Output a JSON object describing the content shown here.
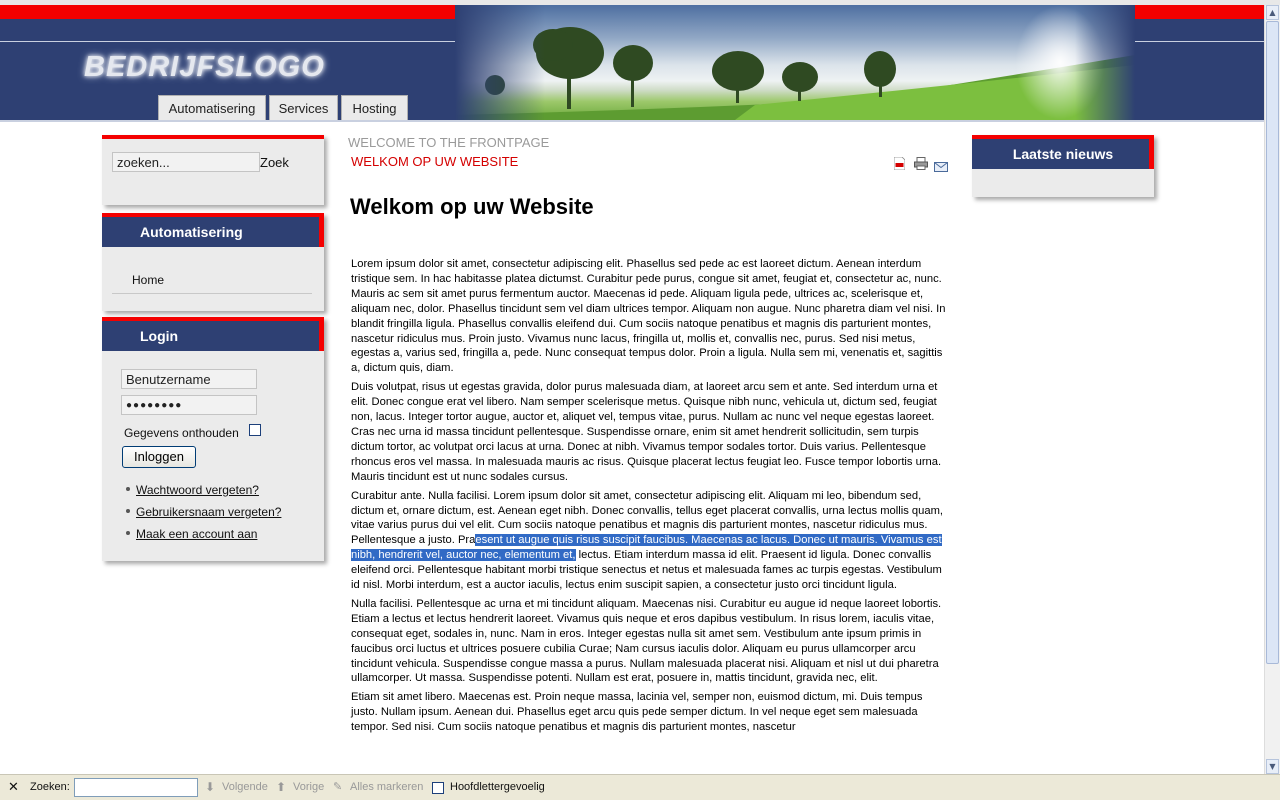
{
  "header": {
    "logo": "BEDRIJFSLOGO",
    "nav_tabs": [
      {
        "label": "Automatisering"
      },
      {
        "label": "Services"
      },
      {
        "label": "Hosting"
      }
    ]
  },
  "search_panel": {
    "input_value": "zoeken...",
    "button_label": "Zoek"
  },
  "menu_panel": {
    "title": "Automatisering",
    "items": [
      {
        "label": "Home"
      }
    ]
  },
  "login_panel": {
    "title": "Login",
    "username_value": "Benutzername",
    "password_value": "●●●●●●●●",
    "remember_label": "Gegevens onthouden",
    "login_button": "Inloggen",
    "links": [
      {
        "label": "Wachtwoord vergeten?"
      },
      {
        "label": "Gebruikersnaam vergeten?"
      },
      {
        "label": "Maak een account aan"
      }
    ]
  },
  "news_panel": {
    "title": "Laatste nieuws"
  },
  "content": {
    "pathway": "WELCOME TO THE FRONTPAGE",
    "section_title": "WELKOM OP UW WEBSITE",
    "heading": "Welkom op uw Website",
    "icons": [
      "pdf-icon",
      "print-icon",
      "email-icon"
    ],
    "paragraphs": [
      "Lorem ipsum dolor sit amet, consectetur adipiscing elit. Phasellus sed pede ac est laoreet dictum. Aenean interdum tristique sem. In hac habitasse platea dictumst. Curabitur pede purus, congue sit amet, feugiat et, consectetur ac, nunc. Mauris ac sem sit amet purus fermentum auctor. Maecenas id pede. Aliquam ligula pede, ultrices ac, scelerisque et, aliquam nec, dolor. Phasellus tincidunt sem vel diam ultrices tempor. Aliquam non augue. Nunc pharetra diam vel nisi. In blandit fringilla ligula. Phasellus convallis eleifend dui. Cum sociis natoque penatibus et magnis dis parturient montes, nascetur ridiculus mus. Proin justo. Vivamus nunc lacus, fringilla ut, mollis et, convallis nec, purus. Sed nisi metus, egestas a, varius sed, fringilla a, pede. Nunc consequat tempus dolor. Proin a ligula. Nulla sem mi, venenatis et, sagittis a, dictum quis, diam.",
      "Duis volutpat, risus ut egestas gravida, dolor purus malesuada diam, at laoreet arcu sem et ante. Sed interdum urna et elit. Donec congue erat vel libero. Nam semper scelerisque metus. Quisque nibh nunc, vehicula ut, dictum sed, feugiat non, lacus. Integer tortor augue, auctor et, aliquet vel, tempus vitae, purus. Nullam ac nunc vel neque egestas laoreet. Cras nec urna id massa tincidunt pellentesque. Suspendisse ornare, enim sit amet hendrerit sollicitudin, sem turpis dictum tortor, ac volutpat orci lacus at urna. Donec at nibh. Vivamus tempor sodales tortor. Duis varius. Pellentesque rhoncus eros vel massa. In malesuada mauris ac risus. Quisque placerat lectus feugiat leo. Fusce tempor lobortis urna. Mauris tincidunt est ut nunc sodales cursus."
    ],
    "para3_before": "Curabitur ante. Nulla facilisi. Lorem ipsum dolor sit amet, consectetur adipiscing elit. Aliquam mi leo, bibendum sed, dictum et, ornare dictum, est. Aenean eget nibh. Donec convallis, tellus eget placerat convallis, urna lectus mollis quam, vitae varius purus dui vel elit. Cum sociis natoque penatibus et magnis dis parturient montes, nascetur ridiculus mus. Pellentesque a justo. Pra",
    "para3_highlight": "esent ut augue quis risus suscipit faucibus. Maecenas ac lacus. Donec ut mauris. Vivamus est nibh, hendrerit vel, auctor nec, elementum et,",
    "para3_after": " lectus. Etiam interdum massa id elit. Praesent id ligula. Donec convallis eleifend orci. Pellentesque habitant morbi tristique senectus et netus et malesuada fames ac turpis egestas. Vestibulum id nisl. Morbi interdum, est a auctor iaculis, lectus enim suscipit sapien, a consectetur justo orci tincidunt ligula.",
    "para4": "Nulla facilisi. Pellentesque ac urna et mi tincidunt aliquam. Maecenas nisi. Curabitur eu augue id neque laoreet lobortis. Etiam a lectus et lectus hendrerit laoreet. Vivamus quis neque et eros dapibus vestibulum. In risus lorem, iaculis vitae, consequat eget, sodales in, nunc. Nam in eros. Integer egestas nulla sit amet sem. Vestibulum ante ipsum primis in faucibus orci luctus et ultrices posuere cubilia Curae; Nam cursus iaculis dolor. Aliquam eu purus ullamcorper arcu tincidunt vehicula. Suspendisse congue massa a purus. Nullam malesuada placerat nisi. Aliquam et nisl ut dui pharetra ullamcorper. Ut massa. Suspendisse potenti. Nullam est erat, posuere in, mattis tincidunt, gravida nec, elit.",
    "para5": "Etiam sit amet libero. Maecenas est. Proin neque massa, lacinia vel, semper non, euismod dictum, mi. Duis tempus justo. Nullam ipsum. Aenean dui. Phasellus eget arcu quis pede semper dictum. In vel neque eget sem malesuada tempor. Sed nisi. Cum sociis natoque penatibus et magnis dis parturient montes, nascetur"
  },
  "findbar": {
    "close_glyph": "✕",
    "label": "Zoeken:",
    "input_value": "",
    "next": "Volgende",
    "previous": "Vorige",
    "highlight_all": "Alles markeren",
    "match_case": "Hoofdlettergevoelig"
  }
}
